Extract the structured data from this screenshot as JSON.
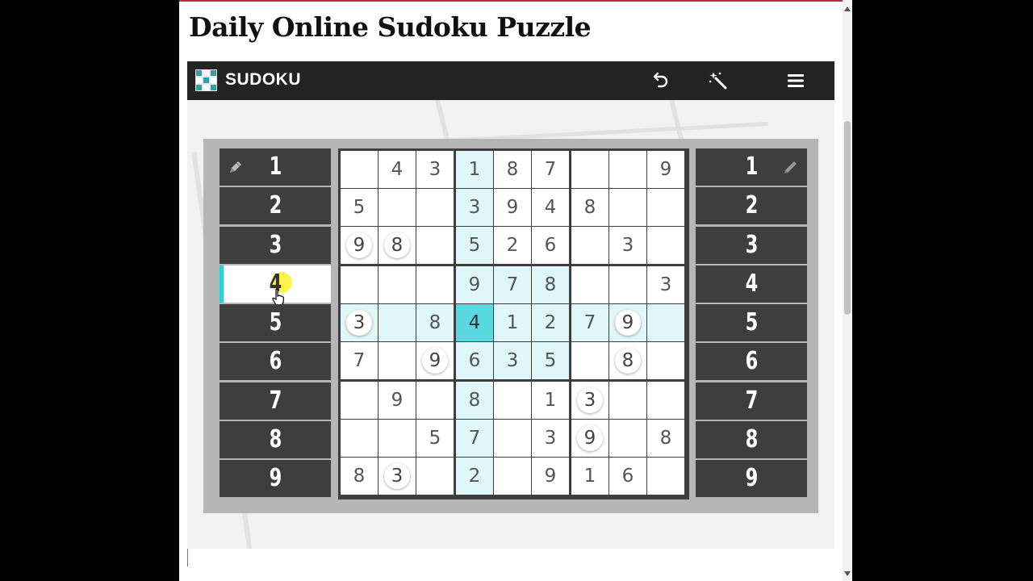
{
  "page": {
    "title": "Daily Online Sudoku Puzzle"
  },
  "toolbar": {
    "brand": "SUDOKU",
    "icons": {
      "logo": "sudoku-logo-icon",
      "undo": "undo-icon",
      "hint": "magic-wand-icon",
      "menu": "hamburger-menu-icon"
    }
  },
  "colors": {
    "toolbar": "#232323",
    "number_button": "#3e3e3e",
    "highlight": "#dff7f8",
    "selected": "#5ad8e0",
    "accent": "#2ed0d8"
  },
  "number_pad": {
    "left": [
      "1",
      "2",
      "3",
      "4",
      "5",
      "6",
      "7",
      "8",
      "9"
    ],
    "right": [
      "1",
      "2",
      "3",
      "4",
      "5",
      "6",
      "7",
      "8",
      "9"
    ],
    "active_left": "4",
    "left_mode_icon": "pen-icon",
    "right_mode_icon": "pencil-icon"
  },
  "board": {
    "grid": [
      [
        "",
        "4",
        "3",
        "1",
        "8",
        "7",
        "",
        "",
        "9"
      ],
      [
        "5",
        "",
        "",
        "3",
        "9",
        "4",
        "8",
        "",
        ""
      ],
      [
        "9",
        "8",
        "",
        "5",
        "2",
        "6",
        "",
        "3",
        ""
      ],
      [
        "",
        "",
        "",
        "9",
        "7",
        "8",
        "",
        "",
        "3"
      ],
      [
        "3",
        "",
        "8",
        "4",
        "1",
        "2",
        "7",
        "9",
        ""
      ],
      [
        "7",
        "",
        "9",
        "6",
        "3",
        "5",
        "",
        "8",
        ""
      ],
      [
        "",
        "9",
        "",
        "8",
        "",
        "1",
        "3",
        "",
        ""
      ],
      [
        "",
        "",
        "5",
        "7",
        "",
        "3",
        "9",
        "",
        "8"
      ],
      [
        "8",
        "3",
        "",
        "2",
        "",
        "9",
        "1",
        "6",
        ""
      ]
    ],
    "user_entered": [
      [
        2,
        0
      ],
      [
        2,
        1
      ],
      [
        4,
        0
      ],
      [
        4,
        7
      ],
      [
        5,
        2
      ],
      [
        5,
        7
      ],
      [
        6,
        6
      ],
      [
        7,
        6
      ],
      [
        8,
        1
      ]
    ],
    "selected": [
      4,
      3
    ]
  }
}
